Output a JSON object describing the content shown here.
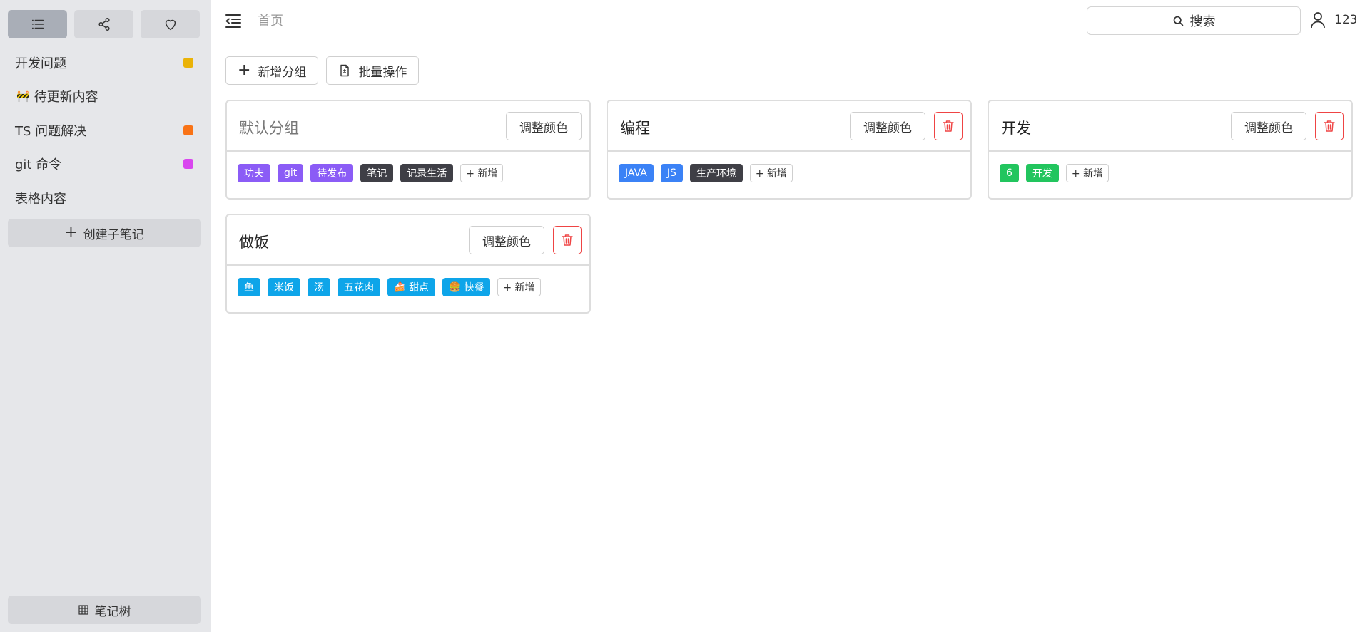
{
  "colors": {
    "sidebar_bg": "#e6e7ea",
    "danger": "#ef4444",
    "purple": "#8b5cf6",
    "dark": "#3f3f46",
    "blue": "#3b82f6",
    "green": "#22c55e",
    "sky": "#0ea5e9"
  },
  "sidebar": {
    "tabs": [
      {
        "icon": "list-icon",
        "active": true
      },
      {
        "icon": "share-icon",
        "active": false
      },
      {
        "icon": "heart-icon",
        "active": false
      }
    ],
    "notes": [
      {
        "label": "开发问题",
        "dot_color": "#eab308"
      },
      {
        "label": "待更新内容",
        "emoji": "🚧"
      },
      {
        "label": "TS 问题解决",
        "dot_color": "#f97316"
      },
      {
        "label": "git 命令",
        "dot_color": "#d946ef"
      },
      {
        "label": "表格内容"
      }
    ],
    "create_label": "创建子笔记",
    "tree_label": "笔记树"
  },
  "header": {
    "breadcrumb": "首页",
    "search_label": "搜索",
    "username": "123"
  },
  "toolbar": {
    "add_group_label": "新增分组",
    "batch_label": "批量操作"
  },
  "common": {
    "adjust_color_label": "调整颜色",
    "add_tag_label": "+ 新增"
  },
  "groups": [
    {
      "title": "默认分组",
      "deletable": false,
      "tags": [
        {
          "label": "功夫",
          "color": "#8b5cf6"
        },
        {
          "label": "git",
          "color": "#8b5cf6"
        },
        {
          "label": "待发布",
          "color": "#8b5cf6"
        },
        {
          "label": "笔记",
          "color": "#3f3f46"
        },
        {
          "label": "记录生活",
          "color": "#3f3f46"
        }
      ]
    },
    {
      "title": "编程",
      "deletable": true,
      "tags": [
        {
          "label": "JAVA",
          "color": "#3b82f6"
        },
        {
          "label": "JS",
          "color": "#3b82f6"
        },
        {
          "label": "生产环境",
          "color": "#3f3f46"
        }
      ]
    },
    {
      "title": "开发",
      "deletable": true,
      "tags": [
        {
          "label": "6",
          "color": "#22c55e"
        },
        {
          "label": "开发",
          "color": "#22c55e"
        }
      ]
    },
    {
      "title": "做饭",
      "deletable": true,
      "tags": [
        {
          "label": "鱼",
          "color": "#0ea5e9"
        },
        {
          "label": "米饭",
          "color": "#0ea5e9"
        },
        {
          "label": "汤",
          "color": "#0ea5e9"
        },
        {
          "label": "五花肉",
          "color": "#0ea5e9"
        },
        {
          "label": "甜点",
          "emoji": "🍰",
          "color": "#0ea5e9"
        },
        {
          "label": "快餐",
          "emoji": "🍔",
          "color": "#0ea5e9"
        }
      ]
    }
  ]
}
